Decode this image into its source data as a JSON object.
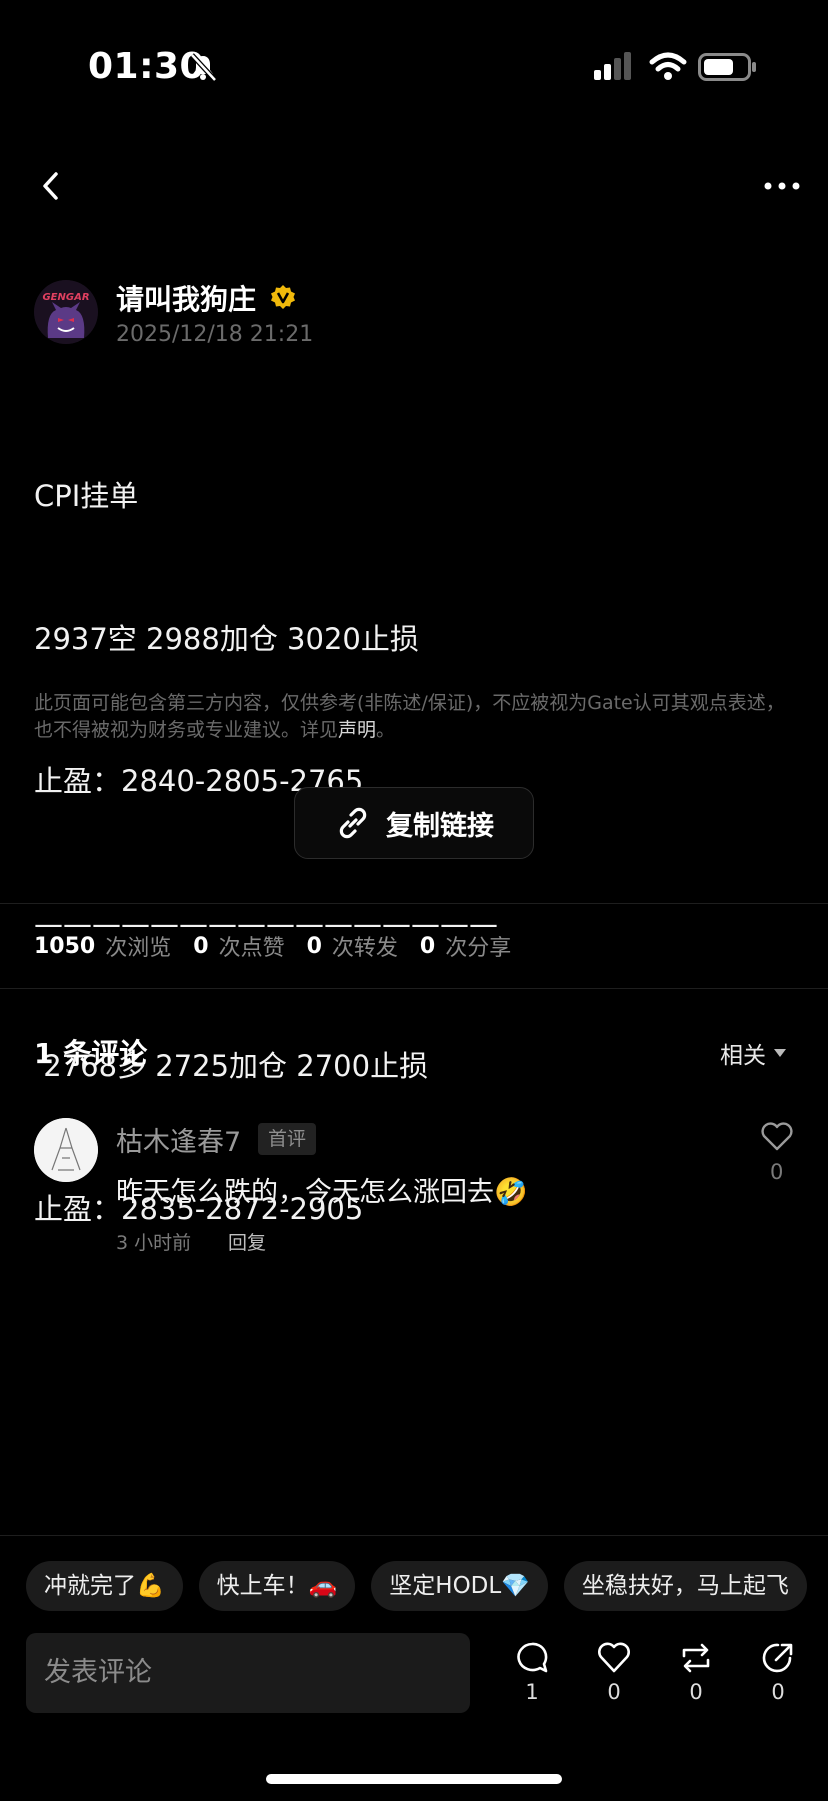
{
  "status_bar": {
    "time": "01:30"
  },
  "author": {
    "name": "请叫我狗庄",
    "date": "2025/12/18 21:21",
    "avatar_text": "GENGAR"
  },
  "post": {
    "lines": [
      "CPI挂单",
      "2937空 2988加仓 3020止损",
      "止盈：2840-2805-2765",
      "————————————————",
      " 2768多 2725加仓 2700止损",
      "止盈：2835-2872-2905"
    ]
  },
  "disclaimer": {
    "text": "此页面可能包含第三方内容，仅供参考(非陈述/保证)，不应被视为Gate认可其观点表述，也不得被视为财务或专业建议。详见",
    "link": "声明",
    "end": "。"
  },
  "copy_link_label": "复制链接",
  "stats": [
    {
      "num": "1050",
      "label": "次浏览"
    },
    {
      "num": "0",
      "label": "次点赞"
    },
    {
      "num": "0",
      "label": "次转发"
    },
    {
      "num": "0",
      "label": "次分享"
    }
  ],
  "comments": {
    "title": "1 条评论",
    "sort_label": "相关",
    "items": [
      {
        "user": "枯木逢春7",
        "badge": "首评",
        "text": "昨天怎么跌的，今天怎么涨回去🤣",
        "time": "3 小时前",
        "reply": "回复",
        "likes": "0"
      }
    ]
  },
  "quick_replies": [
    "冲就完了💪",
    "快上车！🚗",
    "坚定HODL💎",
    "坐稳扶好，马上起飞"
  ],
  "comment_input": {
    "placeholder": "发表评论"
  },
  "actions": [
    {
      "name": "comment",
      "count": "1"
    },
    {
      "name": "like",
      "count": "0"
    },
    {
      "name": "repost",
      "count": "0"
    },
    {
      "name": "share",
      "count": "0"
    }
  ],
  "colors": {
    "background": "#000000",
    "verified_badge": "#f0b90b",
    "text_muted": "#6b6b6b"
  }
}
